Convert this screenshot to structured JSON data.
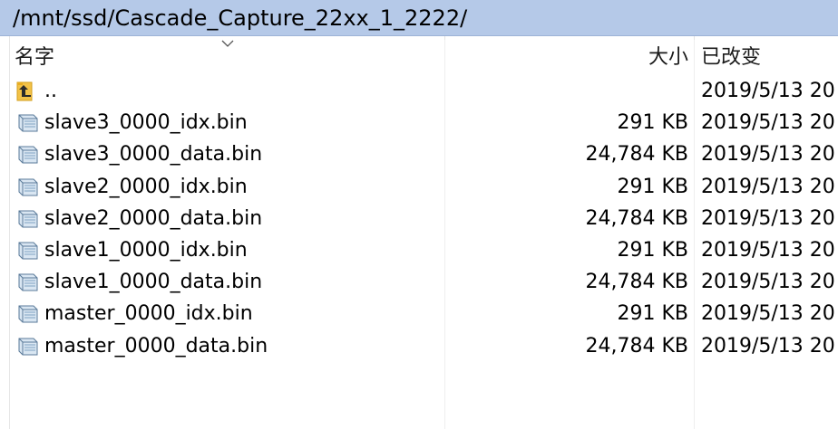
{
  "path": "/mnt/ssd/Cascade_Capture_22xx_1_2222/",
  "columns": {
    "name": "名字",
    "size": "大小",
    "modified": "已改变"
  },
  "sort_icon": "chevron-down-icon",
  "rows": [
    {
      "name": "..",
      "size": "",
      "modified": "2019/5/13 20",
      "icon": "parent-folder-icon"
    },
    {
      "name": "slave3_0000_idx.bin",
      "size": "291 KB",
      "modified": "2019/5/13 20",
      "icon": "file-icon"
    },
    {
      "name": "slave3_0000_data.bin",
      "size": "24,784 KB",
      "modified": "2019/5/13 20",
      "icon": "file-icon"
    },
    {
      "name": "slave2_0000_idx.bin",
      "size": "291 KB",
      "modified": "2019/5/13 20",
      "icon": "file-icon"
    },
    {
      "name": "slave2_0000_data.bin",
      "size": "24,784 KB",
      "modified": "2019/5/13 20",
      "icon": "file-icon"
    },
    {
      "name": "slave1_0000_idx.bin",
      "size": "291 KB",
      "modified": "2019/5/13 20",
      "icon": "file-icon"
    },
    {
      "name": "slave1_0000_data.bin",
      "size": "24,784 KB",
      "modified": "2019/5/13 20",
      "icon": "file-icon"
    },
    {
      "name": "master_0000_idx.bin",
      "size": "291 KB",
      "modified": "2019/5/13 20",
      "icon": "file-icon"
    },
    {
      "name": "master_0000_data.bin",
      "size": "24,784 KB",
      "modified": "2019/5/13 20",
      "icon": "file-icon"
    }
  ]
}
